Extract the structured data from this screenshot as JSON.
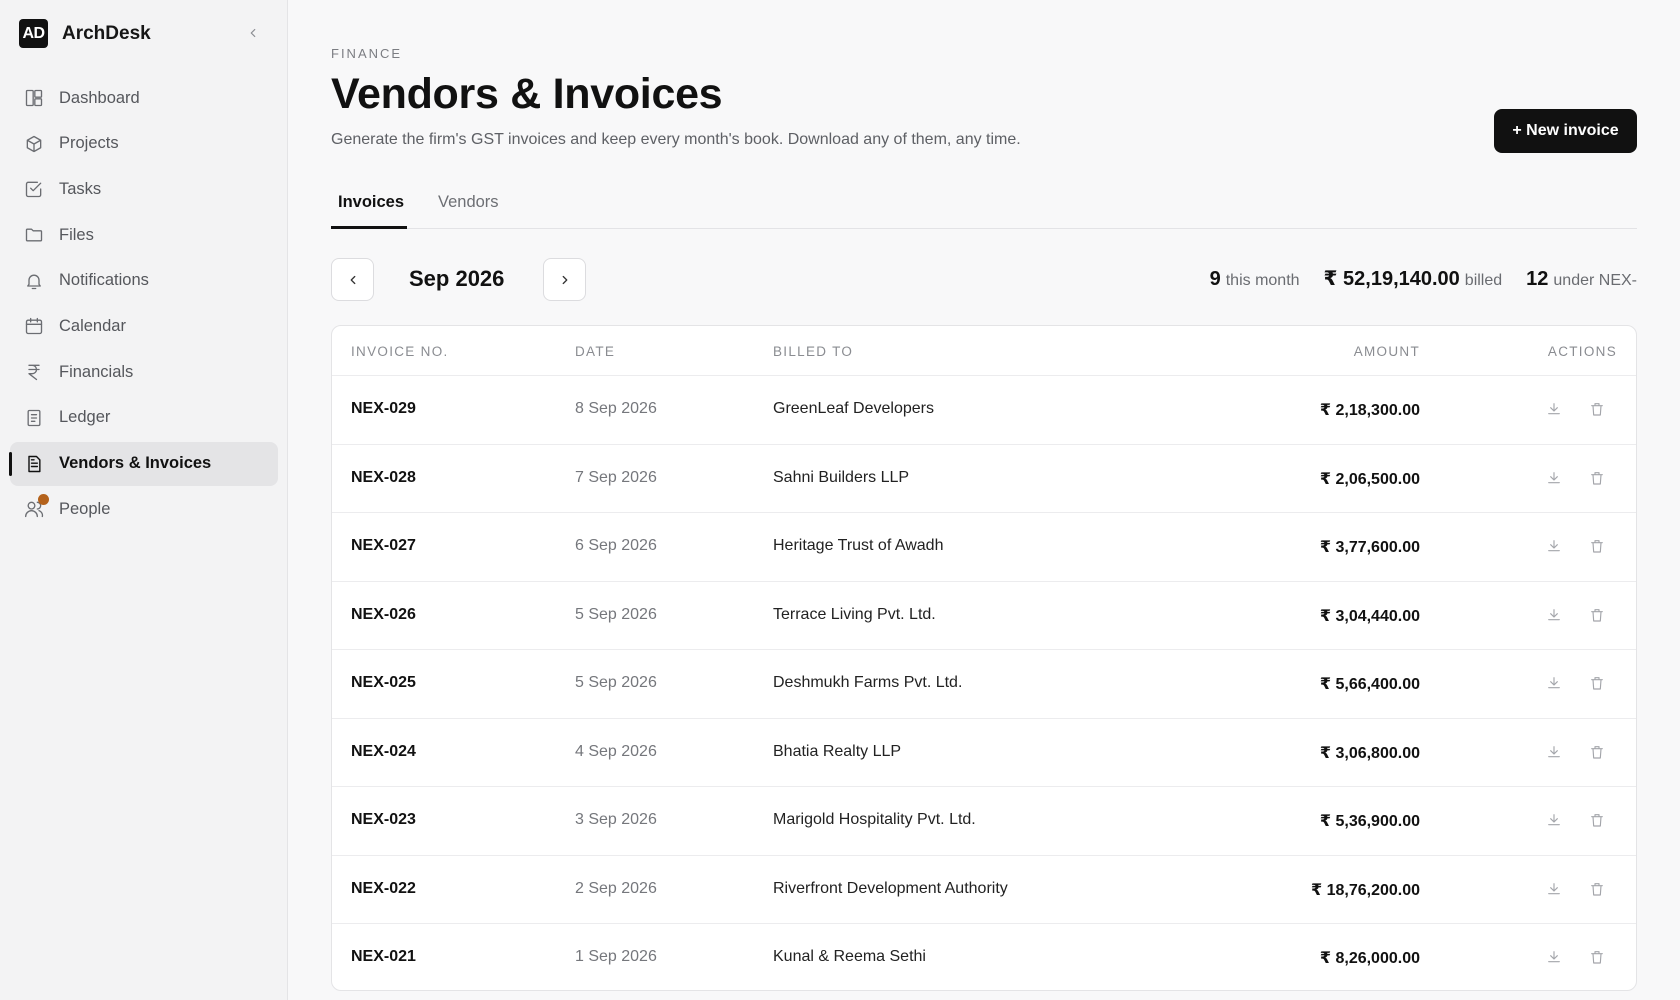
{
  "brand": {
    "logo_text": "AD",
    "name": "ArchDesk"
  },
  "sidebar": {
    "items": [
      {
        "label": "Dashboard",
        "icon": "dashboard-icon"
      },
      {
        "label": "Projects",
        "icon": "box-icon"
      },
      {
        "label": "Tasks",
        "icon": "checkbox-icon"
      },
      {
        "label": "Files",
        "icon": "folder-icon"
      },
      {
        "label": "Notifications",
        "icon": "bell-icon"
      },
      {
        "label": "Calendar",
        "icon": "calendar-icon"
      },
      {
        "label": "Financials",
        "icon": "rupee-icon"
      },
      {
        "label": "Ledger",
        "icon": "ledger-icon"
      },
      {
        "label": "Vendors & Invoices",
        "icon": "document-icon",
        "active": true
      },
      {
        "label": "People",
        "icon": "people-icon",
        "notification_dot": true
      }
    ]
  },
  "header": {
    "eyebrow": "FINANCE",
    "title": "Vendors & Invoices",
    "subtitle": "Generate the firm's GST invoices and keep every month's book. Download any of them, any time.",
    "new_button": "+ New invoice"
  },
  "tabs": [
    {
      "label": "Invoices",
      "active": true
    },
    {
      "label": "Vendors",
      "active": false
    }
  ],
  "month_nav": {
    "label": "Sep 2026"
  },
  "stats": {
    "count_value": "9",
    "count_label": "this month",
    "billed_value": "₹ 52,19,140.00",
    "billed_label": "billed",
    "series_value": "12",
    "series_label": "under NEX-"
  },
  "table": {
    "columns": [
      "INVOICE NO.",
      "DATE",
      "BILLED TO",
      "AMOUNT",
      "ACTIONS"
    ],
    "rows": [
      {
        "no": "NEX-029",
        "date": "8 Sep 2026",
        "billed_to": "GreenLeaf Developers",
        "amount": "₹ 2,18,300.00"
      },
      {
        "no": "NEX-028",
        "date": "7 Sep 2026",
        "billed_to": "Sahni Builders LLP",
        "amount": "₹ 2,06,500.00"
      },
      {
        "no": "NEX-027",
        "date": "6 Sep 2026",
        "billed_to": "Heritage Trust of Awadh",
        "amount": "₹ 3,77,600.00"
      },
      {
        "no": "NEX-026",
        "date": "5 Sep 2026",
        "billed_to": "Terrace Living Pvt. Ltd.",
        "amount": "₹ 3,04,440.00"
      },
      {
        "no": "NEX-025",
        "date": "5 Sep 2026",
        "billed_to": "Deshmukh Farms Pvt. Ltd.",
        "amount": "₹ 5,66,400.00"
      },
      {
        "no": "NEX-024",
        "date": "4 Sep 2026",
        "billed_to": "Bhatia Realty LLP",
        "amount": "₹ 3,06,800.00"
      },
      {
        "no": "NEX-023",
        "date": "3 Sep 2026",
        "billed_to": "Marigold Hospitality Pvt. Ltd.",
        "amount": "₹ 5,36,900.00"
      },
      {
        "no": "NEX-022",
        "date": "2 Sep 2026",
        "billed_to": "Riverfront Development Authority",
        "amount": "₹ 18,76,200.00"
      },
      {
        "no": "NEX-021",
        "date": "1 Sep 2026",
        "billed_to": "Kunal & Reema Sethi",
        "amount": "₹ 8,26,000.00"
      }
    ]
  },
  "colors": {
    "accent": "#111111",
    "notification": "#b4621b",
    "sidebar_bg": "#f3f3f4"
  }
}
